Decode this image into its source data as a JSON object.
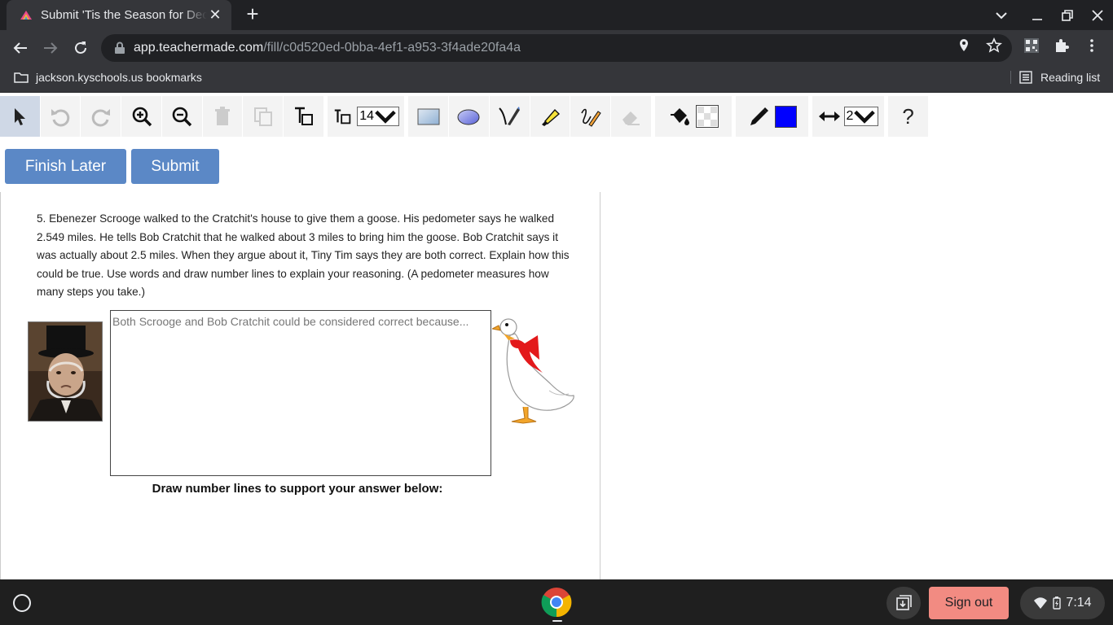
{
  "browser": {
    "tab_title": "Submit 'Tis the Season for Decimals",
    "url_host": "app.teachermade.com",
    "url_path": "/fill/c0d520ed-0bba-4ef1-a953-3f4ade20fa4a",
    "bookmarks_folder": "jackson.kyschools.us bookmarks",
    "reading_list": "Reading list"
  },
  "tools": {
    "font_size": "14",
    "line_width": "2",
    "stroke_color": "#0000ff",
    "help": "?"
  },
  "actions": {
    "finish_later": "Finish Later",
    "submit": "Submit"
  },
  "worksheet": {
    "question": "5. Ebenezer Scrooge walked to the Cratchit's house to give them a goose. His pedometer says he walked 2.549 miles. He tells Bob Cratchit that he walked about 3 miles to bring him the goose. Bob Cratchit says it was actually about 2.5 miles. When they argue about it, Tiny Tim says they are both correct. Explain how this could be true. Use words and draw number lines to explain your reasoning. (A pedometer measures how many steps you take.)",
    "answer_placeholder": "Both Scrooge and Bob Cratchit could be considered correct because...",
    "answer_value": "",
    "number_line_prompt": "Draw number lines to support your answer below:"
  },
  "shelf": {
    "sign_out": "Sign out",
    "time": "7:14"
  }
}
